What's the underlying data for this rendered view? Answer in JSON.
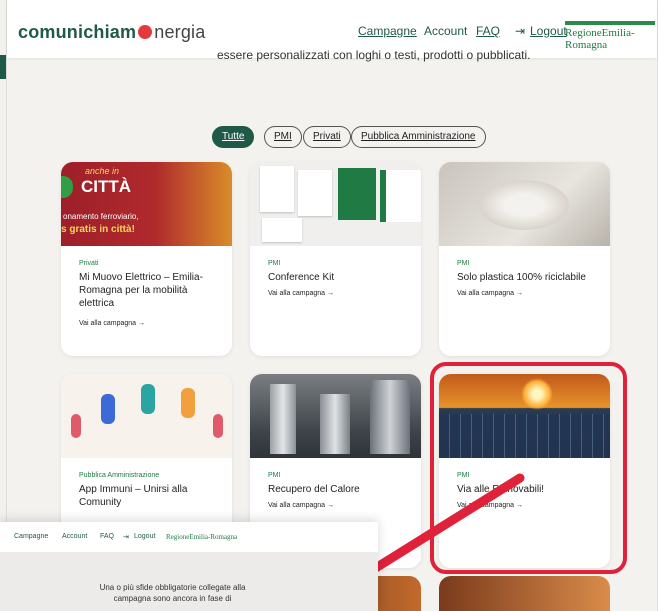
{
  "header": {
    "logo_part1": "comunichiam",
    "logo_part2": "nergia",
    "nav": [
      "Campagne",
      "Account",
      "FAQ",
      "Logout"
    ],
    "region": "RegioneEmilia-Romagna",
    "subline": "essere personalizzati con loghi o testi, prodotti o pubblicati."
  },
  "filters": [
    "Tutte",
    "PMI",
    "Privati",
    "Pubblica Amministrazione"
  ],
  "cards": [
    {
      "category": "Privati",
      "title": "Mi Muovo Elettrico – Emilia-Romagna per la mobilità elettrica",
      "link": "Vai alla campagna →",
      "img_text_1": "anche in",
      "img_text_2": "CITTÀ",
      "img_text_3": "onamento ferroviario,",
      "img_text_4": "s gratis in città!"
    },
    {
      "category": "PMI",
      "title": "Conference Kit",
      "link": "Vai alla campagna →"
    },
    {
      "category": "PMI",
      "title": "Solo plastica 100% riciclabile",
      "link": "Vai alla campagna →"
    },
    {
      "category": "Pubblica Amministrazione",
      "title": "App Immuni – Unirsi alla Comunity",
      "link": ""
    },
    {
      "category": "PMI",
      "title": "Recupero del Calore",
      "link": "Vai alla campagna →"
    },
    {
      "category": "PMI",
      "title": "Via alle Rinnovabili!",
      "link": "Vai alla campagna →"
    }
  ],
  "overlay": {
    "nav": [
      "Campagne",
      "Account",
      "FAQ",
      "Logout"
    ],
    "region": "RegioneEmilia-Romagna",
    "text_1": "Una o più sfide obbligatorie collegate alla",
    "text_2": "campagna sono ancora in fase di"
  },
  "colors": {
    "brand_green": "#1f5a48",
    "accent_red": "#e0213a"
  }
}
